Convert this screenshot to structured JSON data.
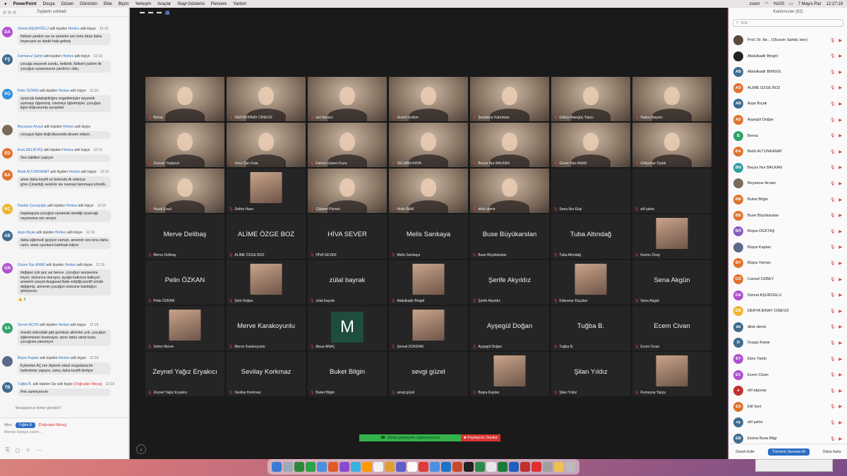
{
  "menubar": {
    "app": "PowerPoint",
    "items": [
      "Dosya",
      "Düzen",
      "Görünüm",
      "Ekle",
      "Biçim",
      "Yerleşim",
      "Araçlar",
      "Slayt Gösterisi",
      "Pencere",
      "Yardım"
    ],
    "zoom_label": "zoom",
    "battery": "%100",
    "date": "7 Mayıs Paz",
    "time": "12:27:19"
  },
  "chat": {
    "title": "Toplantı sohbeti",
    "messages": [
      {
        "initials": "DA",
        "color": "#b04fd0",
        "name": "Demet AŞUROĞLU",
        "mid": " adlı kişiden ",
        "to": "Herkes",
        "end": " adlı kişiye",
        "time": "12:15",
        "text": "fiziksel yardım var ve annenin ses tonu biraz daha heyecanlı ve istekli hale gelmiş"
      },
      {
        "initials": "FŞ",
        "color": "#3f6b8f",
        "name": "Fatmanur Şahin",
        "mid": " adlı kişiden ",
        "to": "Herkes",
        "end": " adlı kişiye",
        "time": "12:16",
        "text": "çocuğa seçenek sundu, bekledi, fiziksel yardım ile çocuğun oynamasına yardımcı oldu."
      },
      {
        "initials": "PÖ",
        "color": "#2d8fe0",
        "name": "Pelin ÖZKAN",
        "mid": " adlı kişiden ",
        "to": "Herkes",
        "end": " adlı kişiye",
        "time": "12:16",
        "text": "oyuncak kalabalıklığını engellemişler seçenek sunmayı öğrenmiş. istemeyi öğretmişler. çocuğun ilgisi doğrusunda oynadılar"
      },
      {
        "initials": "",
        "color": "#7a6a5a",
        "name": "Beyzanur Arvasi",
        "mid": " adlı kişiden ",
        "to": "Herkes",
        "end": " adlı kişiye",
        "time": "",
        "text": "cocugun ilgisi doğrultusunda devam ediyor."
      },
      {
        "initials": "ED",
        "color": "#e0722d",
        "name": "Esra DELİKTAŞ",
        "mid": " adlı kişiden ",
        "to": "Herkes",
        "end": " adlı kişiye",
        "time": "12:16",
        "text": "Ses taklitleri yapıyor"
      },
      {
        "initials": "BA",
        "color": "#e0722d",
        "name": "Betül ALTUNKANAT",
        "mid": " adlı kişiden ",
        "to": "Herkes",
        "end": " adlı kişiye",
        "time": "12:16",
        "text": "anne daha keyifli ve farkında ilk videoya göre.Çıkardığı seslerle ise nesneyi tanımaya yönelik."
      },
      {
        "initials": "HÇ",
        "color": "#f0b429",
        "name": "Hasibe Çavuşoğlu",
        "mid": " adlı kişiden ",
        "to": "Herkes",
        "end": " adlı kişiye",
        "time": "12:16",
        "text": "başlangıçta çocuğun oynamak istediği oyuncağı seçmesine izin veriyor"
      },
      {
        "initials": "AB",
        "color": "#3f6b8f",
        "name": "Ayşe Bıçak",
        "mid": " adlı kişiden ",
        "to": "Herkes",
        "end": " adlı kişiye",
        "time": "12:16",
        "text": "daha eğlenceli geçiyor zaman, annenin ses tonu daha canlı, anne oyunlara katılmak istiyor"
      },
      {
        "initials": "GN",
        "color": "#b04fd0",
        "name": "Gizem Nur ANAR",
        "mid": " adlı kişiden ",
        "to": "Herkes",
        "end": " adlı kişiye",
        "time": "12:16",
        "text": "değişen çok şey var bence. çocuğun seviyesine iniyor; oturunca oturuyor, ayağa kalkınca kalkıyor. annenin sosyal duygusal ifade edişliği pozitif yönde değişmiş. annenin çocuğun sürecine katıldığını görüyoruz."
      },
      {
        "initials": "SA",
        "color": "#2fa36b",
        "name": "Servet ACUN",
        "mid": " adlı kişiden ",
        "to": "Herkes",
        "end": " adlı kişiye",
        "time": "12:19",
        "text": "önceki videodaki gibi gereksiz aferinler yok, çocuğun eğlenmesini önemsiyor, anne daha rahat bunu çocuğuna yansıtıyor"
      },
      {
        "initials": "",
        "color": "#5a6a8a",
        "name": "Büşra Kaplan",
        "mid": " adlı kişiden ",
        "to": "Herkes",
        "end": " adlı kişiye",
        "time": "12:19",
        "text": "Eylemleri AÇ tım diyerek vokal vurgulama ile betimleme yapıyor, süreç daha keyifli ilerliyor"
      },
      {
        "initials": "TB",
        "color": "#3f6b8f",
        "name": "Tuğba B.",
        "mid": " adlı kişiden Siz adlı kişiye ",
        "to": "(Doğrudan Mesaj)",
        "end": "",
        "time": "12:23",
        "text": "Pek sanmıyorum"
      }
    ],
    "reaction": "👍 3",
    "who_can_see": "Mesajlarınızı kimler görebilir?",
    "to_label": "Alıcı:",
    "to_value": "Tuğba B.",
    "to_dm": "(Doğrudan Mesaj)",
    "placeholder": "Mesajı buraya yazın..."
  },
  "grid": [
    {
      "kind": "video",
      "name": "Berna"
    },
    {
      "kind": "video",
      "name": "DERYA BİNAY CİNEVİZ"
    },
    {
      "kind": "video",
      "name": "izel denizci"
    },
    {
      "kind": "video",
      "name": "Gizem Erdem"
    },
    {
      "kind": "video",
      "name": "Şeydanur Kahriman"
    },
    {
      "kind": "video",
      "name": "Gökçe Atangüç Topcu"
    },
    {
      "kind": "video",
      "name": "Hatice Bayam"
    },
    {
      "kind": "video",
      "name": "Zeycan Yeşilyurt"
    },
    {
      "kind": "video",
      "name": "Onur Can Kula"
    },
    {
      "kind": "video",
      "name": "Fatma Gülsen Kuzu"
    },
    {
      "kind": "video",
      "name": "SELMAN KAYA"
    },
    {
      "kind": "video",
      "name": "Beyza Nur BALKAN"
    },
    {
      "kind": "video",
      "name": "Gizem Nur ANAR"
    },
    {
      "kind": "video",
      "name": "Gökçenur Üçdal"
    },
    {
      "kind": "video",
      "name": "Hazal Ersal"
    },
    {
      "kind": "pic",
      "name": "Zeliha Hazır"
    },
    {
      "kind": "video",
      "name": "Çiğdem Pürnek"
    },
    {
      "kind": "video",
      "name": "Helin İNAK"
    },
    {
      "kind": "video",
      "name": "dilek demir"
    },
    {
      "kind": "plain",
      "center": "",
      "name": "Sena Nur Ekşi"
    },
    {
      "kind": "plain",
      "center": "",
      "name": "elif şahin"
    },
    {
      "kind": "plain",
      "center": "Merve Delibaş",
      "name": "Merve Delibaş"
    },
    {
      "kind": "plain",
      "center": "ALİME ÖZGE BOZ",
      "name": "ALİME ÖZGE BOZ"
    },
    {
      "kind": "plain",
      "center": "HİVA SEVER",
      "name": "HİVA SEVER"
    },
    {
      "kind": "plain",
      "center": "Melis Sarıkaya",
      "name": "Melis Sarıkaya"
    },
    {
      "kind": "plain",
      "center": "Buse Büyükarslan",
      "name": "Buse Büyükarslan"
    },
    {
      "kind": "plain",
      "center": "Tuba Altındağ",
      "name": "Tuba Altındağ"
    },
    {
      "kind": "pic",
      "name": "Kumru Özay"
    },
    {
      "kind": "plain",
      "center": "Pelin ÖZKAN",
      "name": "Pelin ÖZKAN"
    },
    {
      "kind": "pic",
      "name": "Şirin Doğan"
    },
    {
      "kind": "plain",
      "center": "zülal bayrak",
      "name": "zülal bayrak"
    },
    {
      "kind": "pic",
      "name": "Abdulkadir Bingöl"
    },
    {
      "kind": "plain",
      "center": "Şerife Akyıldız",
      "name": "Şerife Akyıldız"
    },
    {
      "kind": "pic",
      "name": "Kübranur Küçüker"
    },
    {
      "kind": "plain",
      "center": "Sena Akgün",
      "name": "Sena Akgün"
    },
    {
      "kind": "pic",
      "name": "Seher Merve"
    },
    {
      "kind": "plain",
      "center": "Merve Karakoyunlu",
      "name": "Merve Karakoyunlu"
    },
    {
      "kind": "letter",
      "letter": "M",
      "name": "Musa ANAÇ"
    },
    {
      "kind": "pic",
      "name": "Şevval DÜNDAR"
    },
    {
      "kind": "plain",
      "center": "Ayşegül Doğan",
      "name": "Ayşegül Doğan"
    },
    {
      "kind": "plain",
      "center": "Tuğba B.",
      "name": "Tuğba B."
    },
    {
      "kind": "plain",
      "center": "Ecem Civan",
      "name": "Ecem Civan"
    },
    {
      "kind": "plain",
      "center": "Zeynel Yağız Eryakıcı",
      "name": "Zeynel Yağız Eryakıcı"
    },
    {
      "kind": "plain",
      "center": "Sevilay Korkmaz",
      "name": "Sevilay Korkmaz"
    },
    {
      "kind": "plain",
      "center": "Buket Bilgin",
      "name": "Buket Bilgin"
    },
    {
      "kind": "plain",
      "center": "sevgi güzel",
      "name": "sevgi güzel"
    },
    {
      "kind": "pic",
      "name": "Büşra Kaplan"
    },
    {
      "kind": "plain",
      "center": "Şilan Yıldız",
      "name": "Şilan Yıldız"
    },
    {
      "kind": "pic",
      "name": "Rumeysa Topçu"
    }
  ],
  "share": {
    "status": "Ekran paylaşımı yapıyorsunuz",
    "stop": "Paylaşımı Durdur"
  },
  "participants": {
    "title": "Katılımcılar (82)",
    "search_placeholder": "Ara",
    "list": [
      {
        "initials": "",
        "color": "#5a4a3a",
        "name": "Prof. Dr. İbr...  (Oturum Sahibi, ben)"
      },
      {
        "initials": "",
        "color": "#222",
        "name": "Abdulkadir Bingöl"
      },
      {
        "initials": "AB",
        "color": "#3f6b8f",
        "name": "Abdulkadir BİNGÖL"
      },
      {
        "initials": "AÖ",
        "color": "#e0722d",
        "name": "ALİME ÖZGE BOZ"
      },
      {
        "initials": "AB",
        "color": "#3f6b8f",
        "name": "Ayşe Bıçak"
      },
      {
        "initials": "AD",
        "color": "#e0722d",
        "name": "Ayşegül Doğan"
      },
      {
        "initials": "B",
        "color": "#2fa36b",
        "name": "Berna"
      },
      {
        "initials": "BA",
        "color": "#e0722d",
        "name": "Betül ALTUNKANAT"
      },
      {
        "initials": "BN",
        "color": "#2f9fa3",
        "name": "Beyza Nur BALKAN"
      },
      {
        "initials": "",
        "color": "#7a6a5a",
        "name": "Beyzanur Arvasi"
      },
      {
        "initials": "BB",
        "color": "#e0722d",
        "name": "Buket Bilgin"
      },
      {
        "initials": "BB",
        "color": "#e0722d",
        "name": "Buse Büyükarslan"
      },
      {
        "initials": "BÖ",
        "color": "#8a5ac4",
        "name": "Büşra ÖĞKTAŞ"
      },
      {
        "initials": "",
        "color": "#5a6a8a",
        "name": "Büşra Kaplan"
      },
      {
        "initials": "BY",
        "color": "#e0722d",
        "name": "Büşra Yaman"
      },
      {
        "initials": "CÖ",
        "color": "#e0722d",
        "name": "Cansel ÖZBEY"
      },
      {
        "initials": "DA",
        "color": "#b04fd0",
        "name": "Demet AŞUROĞLU"
      },
      {
        "initials": "DB",
        "color": "#f0b429",
        "name": "DERYA BİNAY CİNEVİZ"
      },
      {
        "initials": "dd",
        "color": "#3f6b8f",
        "name": "dilek demir"
      },
      {
        "initials": "D",
        "color": "#3f6b8f",
        "name": "Duygu Kazar"
      },
      {
        "initials": "EY",
        "color": "#b04fd0",
        "name": "Ebru Yandı"
      },
      {
        "initials": "EC",
        "color": "#b04fd0",
        "name": "Ecem Civan"
      },
      {
        "initials": "e",
        "color": "#c03030",
        "name": "elif akpınar"
      },
      {
        "initials": "ES",
        "color": "#e0722d",
        "name": "Elif Sert"
      },
      {
        "initials": "eş",
        "color": "#3f6b8f",
        "name": "elif şahin"
      },
      {
        "initials": "EB",
        "color": "#3f6b8f",
        "name": "Emine Buse Bilgi"
      }
    ],
    "invite": "Davet Edin",
    "mute_all": "Tümünü Sessize Al",
    "more": "Daha fazla"
  }
}
